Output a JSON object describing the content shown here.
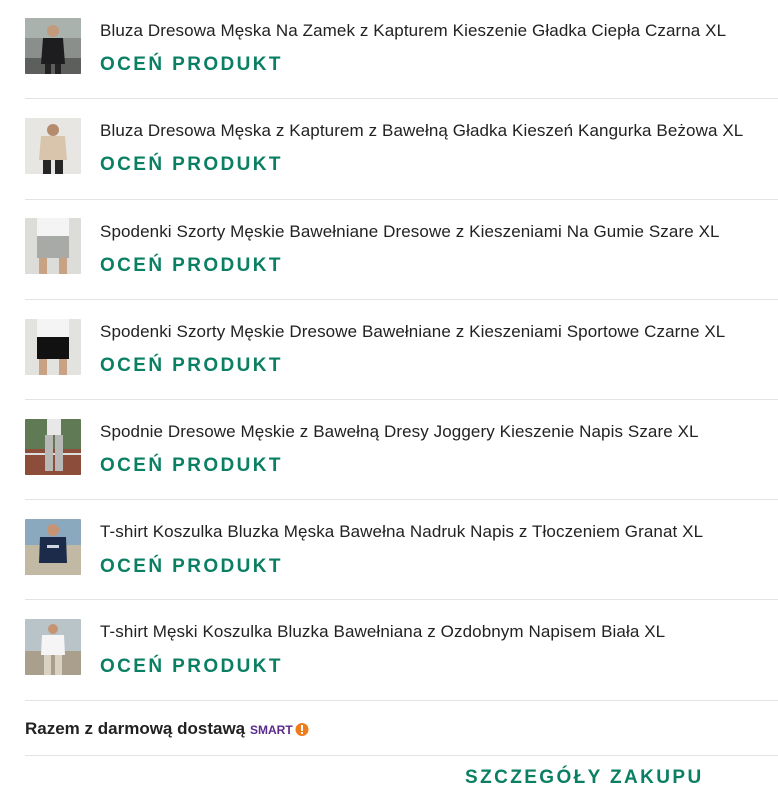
{
  "products": [
    {
      "title": "Bluza Dresowa Męska Na Zamek z Kapturem Kieszenie Gładka Ciepła Czarna XL",
      "action": "OCEŃ PRODUKT"
    },
    {
      "title": "Bluza Dresowa Męska z Kapturem z Bawełną Gładka Kieszeń Kangurka Beżowa XL",
      "action": "OCEŃ PRODUKT"
    },
    {
      "title": "Spodenki Szorty Męskie Bawełniane Dresowe z Kieszeniami Na Gumie Szare XL",
      "action": "OCEŃ PRODUKT"
    },
    {
      "title": "Spodenki Szorty Męskie Dresowe Bawełniane z Kieszeniami Sportowe Czarne XL",
      "action": "OCEŃ PRODUKT"
    },
    {
      "title": "Spodnie Dresowe Męskie z Bawełną Dresy Joggery Kieszenie Napis Szare XL",
      "action": "OCEŃ PRODUKT"
    },
    {
      "title": "T-shirt Koszulka Bluzka Męska Bawełna Nadruk Napis z Tłoczeniem Granat XL",
      "action": "OCEŃ PRODUKT"
    },
    {
      "title": "T-shirt Męski Koszulka Bluzka Bawełniana z Ozdobnym Napisem Biała XL",
      "action": "OCEŃ PRODUKT"
    }
  ],
  "delivery": {
    "text": "Razem z darmową dostawą",
    "badge": "SMART!"
  },
  "details_button": "SZCZEGÓŁY ZAKUPU",
  "colors": {
    "accent": "#0a7f63",
    "smart": "#5b2b8c",
    "smart_badge": "#f07b1a"
  }
}
